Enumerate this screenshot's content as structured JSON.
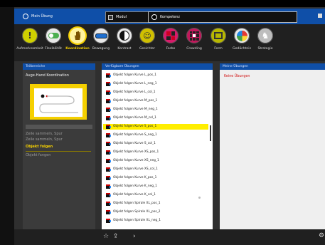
{
  "tabs": [
    {
      "label": "Mein Übung"
    },
    {
      "label": "Modul"
    },
    {
      "label": "Kompetenz"
    }
  ],
  "toolbar": {
    "items": [
      {
        "label": "Aufmerksamkeit",
        "icon": "exclamation-icon"
      },
      {
        "label": "Flexibilität",
        "icon": "toggle-icon"
      },
      {
        "label": "Koordination",
        "icon": "hand-icon",
        "selected": true
      },
      {
        "label": "Bewegung",
        "icon": "motion-icon"
      },
      {
        "label": "Kontrast",
        "icon": "contrast-icon"
      },
      {
        "label": "Gesichter",
        "icon": "smiley-icon"
      },
      {
        "label": "Farbe",
        "icon": "color-icon"
      },
      {
        "label": "Crowding",
        "icon": "crowding-icon"
      },
      {
        "label": "Form",
        "icon": "form-icon"
      },
      {
        "label": "Gedächtnis",
        "icon": "memory-icon"
      },
      {
        "label": "Strategie",
        "icon": "chess-icon"
      }
    ]
  },
  "left_panel": {
    "header": "Teilbereiche",
    "title": "Auge-Hand Koordination",
    "items": [
      {
        "label": "Zeile sammeln, Spur",
        "dim": true
      },
      {
        "label": "Zeile sammeln, Spur",
        "dim": true
      },
      {
        "label": "Objekt folgen",
        "selected": true
      },
      {
        "label": "Objekt fangen",
        "dim": true
      }
    ]
  },
  "list_panel": {
    "header": "Verfügbare Übungen",
    "rows": [
      "Objekt folgen Kurve L_pos_1",
      "Objekt folgen Kurve L_neg_1",
      "Objekt folgen Kurve L_col_1",
      "Objekt folgen Kurve M_pos_1",
      "Objekt folgen Kurve M_neg_1",
      "Objekt folgen Kurve M_col_1",
      "Objekt folgen Kurve S_pos_1",
      "Objekt folgen Kurve S_neg_1",
      "Objekt folgen Kurve S_col_1",
      "Objekt folgen Kurve XS_pos_1",
      "Objekt folgen Kurve XS_neg_1",
      "Objekt folgen Kurve XS_col_1",
      "Objekt folgen Kurve K_pos_1",
      "Objekt folgen Kurve K_neg_1",
      "Objekt folgen Kurve K_col_1",
      "Objekt folgen Spirale XL_pos_1",
      "Objekt folgen Spirale XL_pos_2",
      "Objekt folgen Spirale XL_neg_1"
    ],
    "highlighted_index": 6
  },
  "right_panel": {
    "header": "Meine Übungen",
    "empty_text": "Keine Übungen"
  },
  "colors": {
    "accent_blue": "#0f4fa8",
    "highlight_yellow": "#f5d000"
  }
}
